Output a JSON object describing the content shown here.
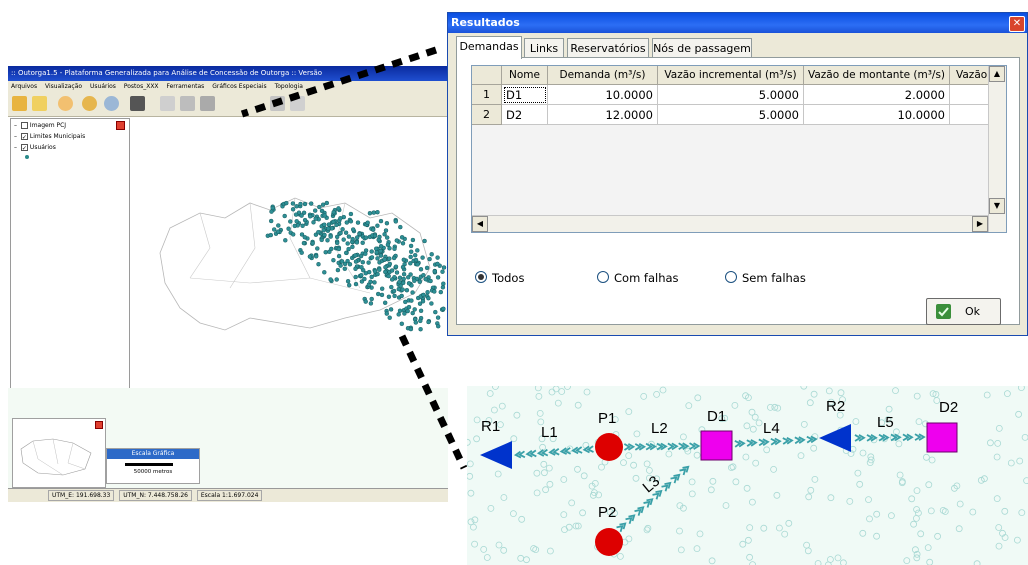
{
  "background_app": {
    "title": ":: Outorga1.5 - Plataforma Generalizada para Análise de Concessão de Outorga :: Versão",
    "menu": [
      "Arquivos",
      "Visualização",
      "Usuários",
      "Postos_XXX",
      "Ferramentas",
      "Gráficos Especiais",
      "Topologia"
    ],
    "layers": [
      {
        "label": "Imagem PCJ",
        "checked": false
      },
      {
        "label": "Limites Municipais",
        "checked": true
      },
      {
        "label": "Usuários",
        "checked": true
      }
    ],
    "scale_title": "Escala Gráfica",
    "scale_value": "50000 metros",
    "status": {
      "utm_e": "UTM_E: 191.698.33",
      "utm_n": "UTM_N: 7.448.758.26",
      "escala": "Escala 1:1.697.024"
    }
  },
  "dialog": {
    "title": "Resultados",
    "close_glyph": "✕",
    "tabs": [
      {
        "label": "Demandas",
        "active": true
      },
      {
        "label": "Links",
        "active": false
      },
      {
        "label": "Reservatórios",
        "active": false
      },
      {
        "label": "Nós de passagem",
        "active": false
      }
    ],
    "columns": [
      "Nome",
      "Demanda (m³/s)",
      "Vazão incremental (m³/s)",
      "Vazão de montante (m³/s)",
      "Vazão t"
    ],
    "rows": [
      {
        "index": "1",
        "nome": "D1",
        "demanda": "10.0000",
        "incremental": "5.0000",
        "montante": "2.0000"
      },
      {
        "index": "2",
        "nome": "D2",
        "demanda": "12.0000",
        "incremental": "5.0000",
        "montante": "10.0000"
      }
    ],
    "radios": [
      {
        "label": "Todos",
        "selected": true
      },
      {
        "label": "Com falhas",
        "selected": false
      },
      {
        "label": "Sem falhas",
        "selected": false
      }
    ],
    "ok_label": "Ok"
  },
  "network": {
    "nodes": [
      "R1",
      "P1",
      "D1",
      "R2",
      "D2",
      "P2"
    ],
    "links": [
      "L1",
      "L2",
      "L3",
      "L4",
      "L5"
    ],
    "colors": {
      "reservoir": "#0033cc",
      "passage": "#dd0000",
      "demand": "#ee00ee",
      "link_arrow": "#3aa0a8"
    }
  },
  "colors": {
    "dialog_title": "#0a4ee0",
    "dotted_line": "#000000"
  }
}
